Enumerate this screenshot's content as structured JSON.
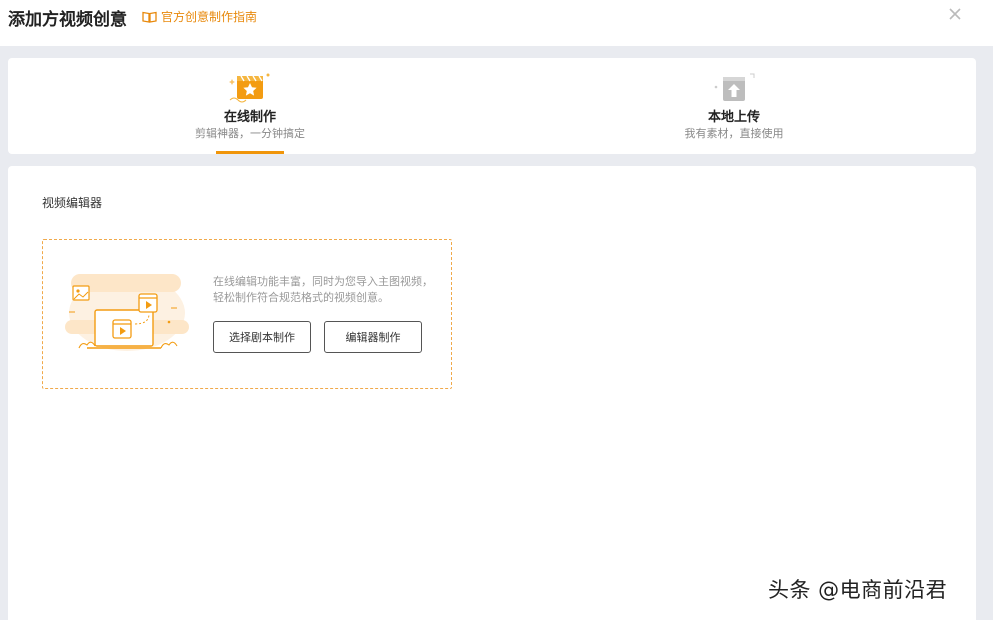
{
  "header": {
    "title": "添加方视频创意",
    "guide_link": "官方创意制作指南"
  },
  "tabs": [
    {
      "label": "在线制作",
      "sub": "剪辑神器，一分钟搞定",
      "active": true,
      "icon": "clapperboard-star-icon"
    },
    {
      "label": "本地上传",
      "sub": "我有素材，直接使用",
      "active": false,
      "icon": "upload-box-icon"
    }
  ],
  "editor": {
    "section_title": "视频编辑器",
    "description": "在线编辑功能丰富，同时为您导入主图视频，轻松制作符合规范格式的视频创意。",
    "buttons": {
      "script": "选择剧本制作",
      "editor": "编辑器制作"
    }
  },
  "watermark": "头条 @电商前沿君",
  "colors": {
    "accent": "#f0950a",
    "guide": "#e8890c",
    "background": "#e9ebf0"
  }
}
